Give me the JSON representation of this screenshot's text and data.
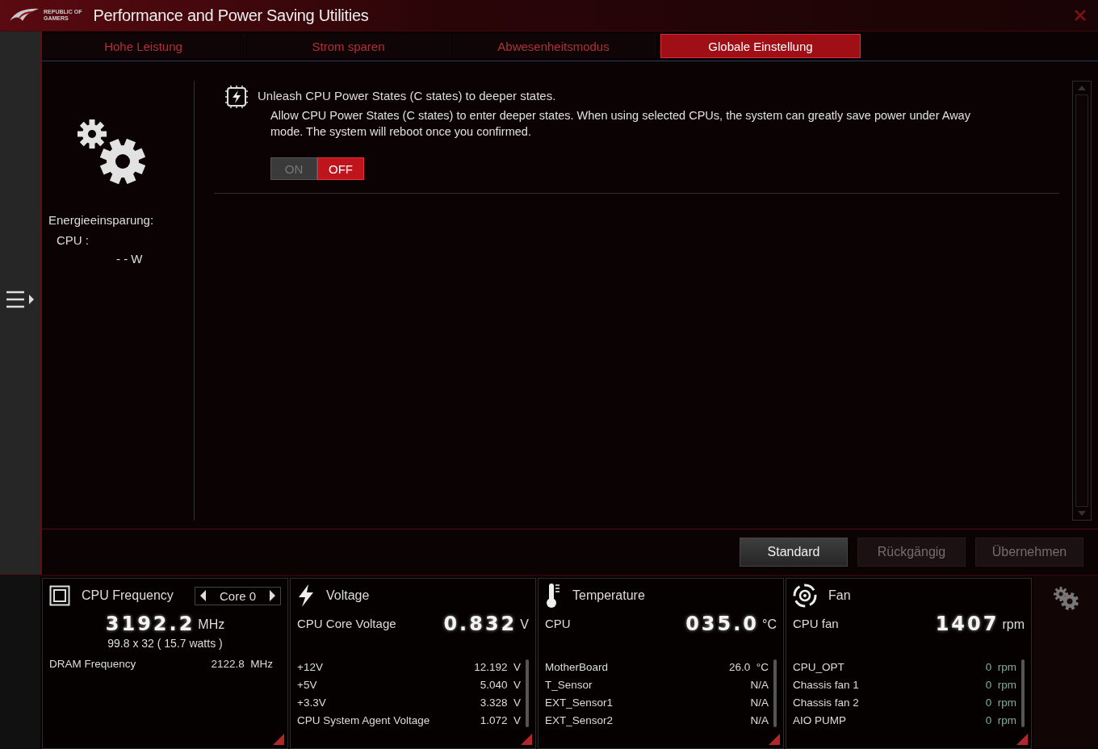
{
  "window": {
    "logo_lines": [
      "REPUBLIC OF",
      "GAMERS"
    ],
    "title": "Performance and Power Saving Utilities"
  },
  "tabs": [
    {
      "label": "Hohe Leistung",
      "selected": false
    },
    {
      "label": "Strom sparen",
      "selected": false
    },
    {
      "label": "Abwesenheitsmodus",
      "selected": false
    },
    {
      "label": "Globale Einstellung",
      "selected": true
    }
  ],
  "summary": {
    "heading": "Energieeinsparung:",
    "cpu_label": "CPU :",
    "cpu_value": "- - W"
  },
  "setting": {
    "title": "Unleash CPU Power States (C states) to deeper states.",
    "description": "Allow CPU Power States (C states) to enter deeper states. When using selected CPUs, the system can greatly save power under Away mode. The system will reboot once you confirmed.",
    "toggle": [
      {
        "label": "ON",
        "selected": false
      },
      {
        "label": "OFF",
        "selected": true
      }
    ]
  },
  "buttons": [
    {
      "label": "Standard",
      "disabled": false
    },
    {
      "label": "Rückgängig",
      "disabled": true
    },
    {
      "label": "Übernehmen",
      "disabled": true
    }
  ],
  "monitors": [
    {
      "kind": "frequency",
      "title": "CPU Frequency",
      "selector": "Core 0",
      "value": "3192.2",
      "unit": "MHz",
      "detail": "99.8  x  32     ( 15.7 watts )",
      "rows": [
        {
          "name": "DRAM Frequency",
          "value": "2122.8",
          "unit": "MHz"
        }
      ]
    },
    {
      "kind": "voltage",
      "title": "Voltage",
      "main_label": "CPU Core Voltage",
      "value": "0.832",
      "unit": "V",
      "rows": [
        {
          "name": "+12V",
          "value": "12.192",
          "unit": "V"
        },
        {
          "name": "+5V",
          "value": "5.040",
          "unit": "V"
        },
        {
          "name": "+3.3V",
          "value": "3.328",
          "unit": "V"
        },
        {
          "name": "CPU System Agent Voltage",
          "value": "1.072",
          "unit": "V"
        }
      ]
    },
    {
      "kind": "temperature",
      "title": "Temperature",
      "main_label": "CPU",
      "value": "035.0",
      "unit": "°C",
      "rows": [
        {
          "name": "MotherBoard",
          "value": "26.0",
          "unit": "°C"
        },
        {
          "name": "T_Sensor",
          "value": "N/A",
          "unit": ""
        },
        {
          "name": "EXT_Sensor1",
          "value": "N/A",
          "unit": ""
        },
        {
          "name": "EXT_Sensor2",
          "value": "N/A",
          "unit": ""
        }
      ]
    },
    {
      "kind": "fan",
      "title": "Fan",
      "main_label": "CPU fan",
      "value": "1407",
      "unit": "rpm",
      "rows": [
        {
          "name": "CPU_OPT",
          "value": "0",
          "unit": "rpm"
        },
        {
          "name": "Chassis fan 1",
          "value": "0",
          "unit": "rpm"
        },
        {
          "name": "Chassis fan 2",
          "value": "0",
          "unit": "rpm"
        },
        {
          "name": "AIO PUMP",
          "value": "0",
          "unit": "rpm"
        }
      ]
    }
  ]
}
